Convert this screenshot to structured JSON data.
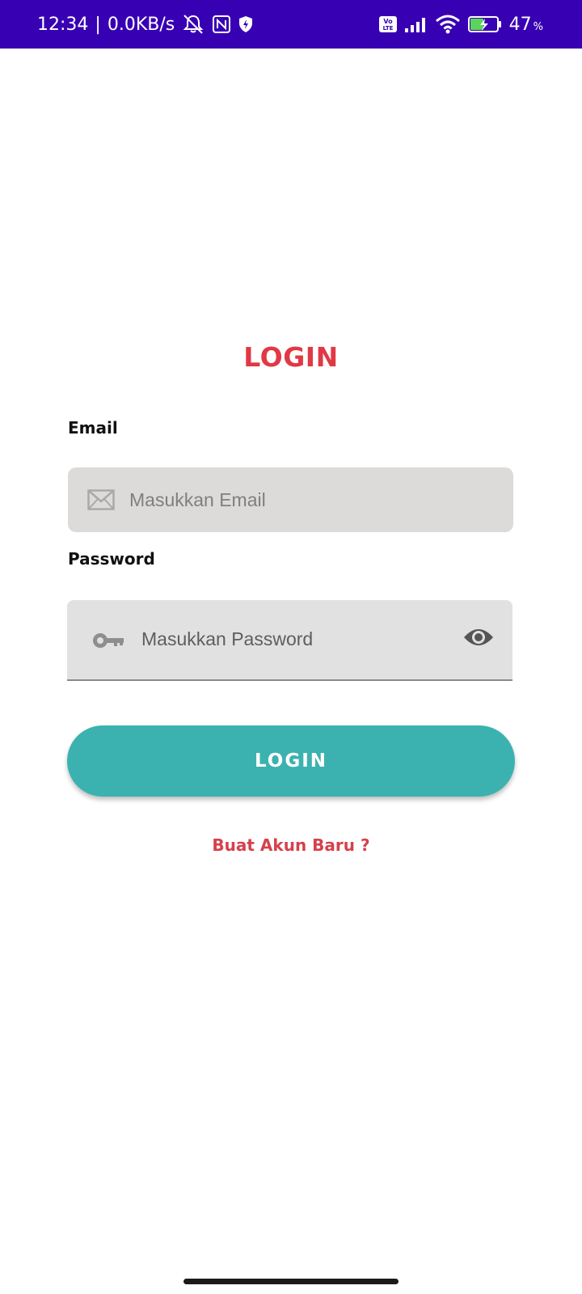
{
  "status_bar": {
    "time": "12:34",
    "separator": "|",
    "net_speed": "0.0KB/s",
    "battery_percent": "47",
    "battery_percent_sign": "%",
    "icons": [
      "alarm-off-icon",
      "nfc-icon",
      "shield-icon",
      "volte-icon",
      "signal-icon",
      "wifi-icon",
      "battery-charging-icon"
    ],
    "background_color": "#3800b3"
  },
  "login": {
    "title": "LOGIN",
    "email_label": "Email",
    "email_placeholder": "Masukkan Email",
    "password_label": "Password",
    "password_placeholder": "Masukkan Password",
    "button_label": "LOGIN",
    "signup_link": "Buat Akun Baru ?",
    "accent_color": "#e03945",
    "button_color": "#3bb2b0"
  }
}
